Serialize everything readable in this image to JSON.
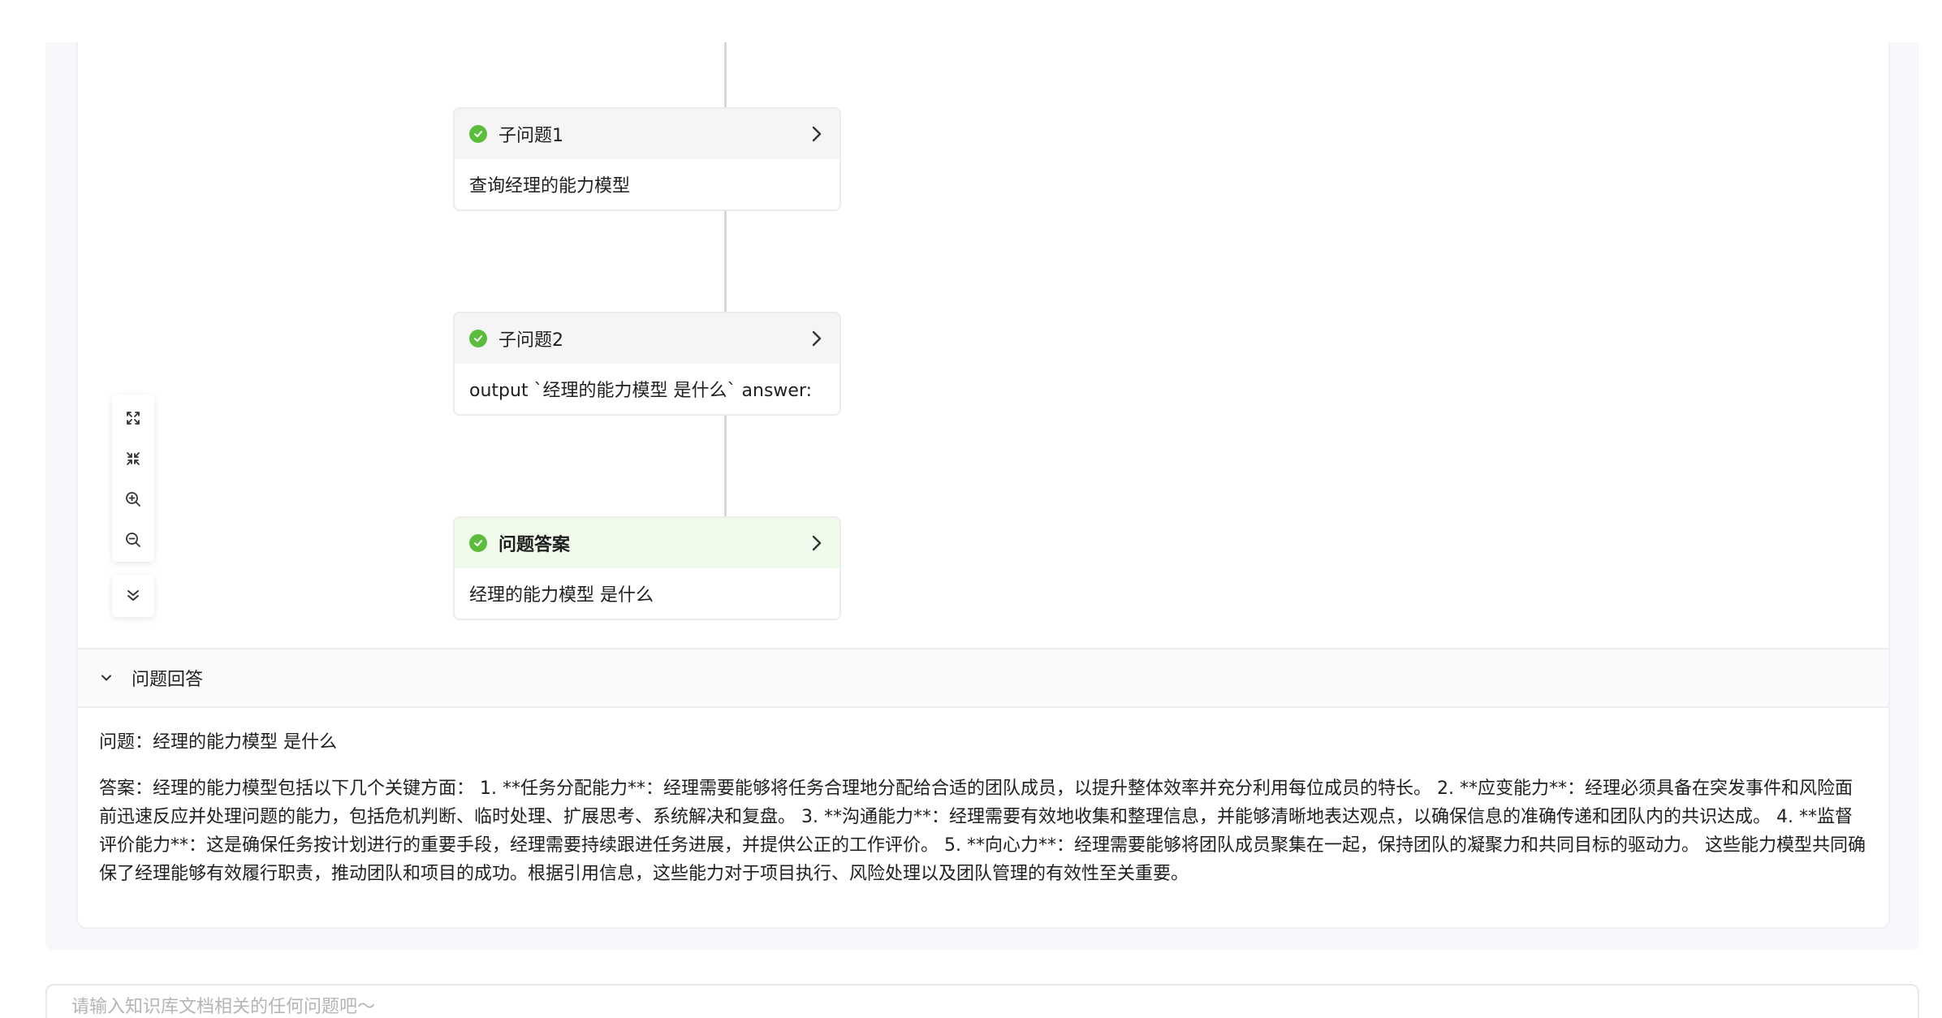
{
  "flow": {
    "nodes": [
      {
        "title": "子问题1",
        "body": "查询经理的能力模型",
        "status": "done",
        "highlight": false
      },
      {
        "title": "子问题2",
        "body": "output `经理的能力模型 是什么` answer:",
        "status": "done",
        "highlight": false
      },
      {
        "title": "问题答案",
        "body": "经理的能力模型 是什么",
        "status": "done",
        "highlight": true
      }
    ],
    "toolbar": [
      "fullscreen-icon",
      "fit-view-icon",
      "zoom-in-icon",
      "zoom-out-icon"
    ],
    "collapse_icon": "double-chevron-down-icon"
  },
  "answer_section": {
    "title": "问题回答",
    "question": "问题：经理的能力模型 是什么",
    "answer": "答案：经理的能力模型包括以下几个关键方面： 1. **任务分配能力**：经理需要能够将任务合理地分配给合适的团队成员，以提升整体效率并充分利用每位成员的特长。 2. **应变能力**：经理必须具备在突发事件和风险面前迅速反应并处理问题的能力，包括危机判断、临时处理、扩展思考、系统解决和复盘。 3. **沟通能力**：经理需要有效地收集和整理信息，并能够清晰地表达观点，以确保信息的准确传递和团队内的共识达成。 4. **监督评价能力**：这是确保任务按计划进行的重要手段，经理需要持续跟进任务进展，并提供公正的工作评价。 5. **向心力**：经理需要能够将团队成员聚集在一起，保持团队的凝聚力和共同目标的驱动力。 这些能力模型共同确保了经理能够有效履行职责，推动团队和项目的成功。根据引用信息，这些能力对于项目执行、风险处理以及团队管理的有效性至关重要。"
  },
  "chat": {
    "placeholder": "请输入知识库文档相关的任何问题吧～",
    "value": ""
  },
  "colors": {
    "success": "#5cbd3c",
    "answer_header_bg": "#f1fbec",
    "node_header_bg": "#f5f5f5",
    "connector": "#d6d6d6"
  }
}
